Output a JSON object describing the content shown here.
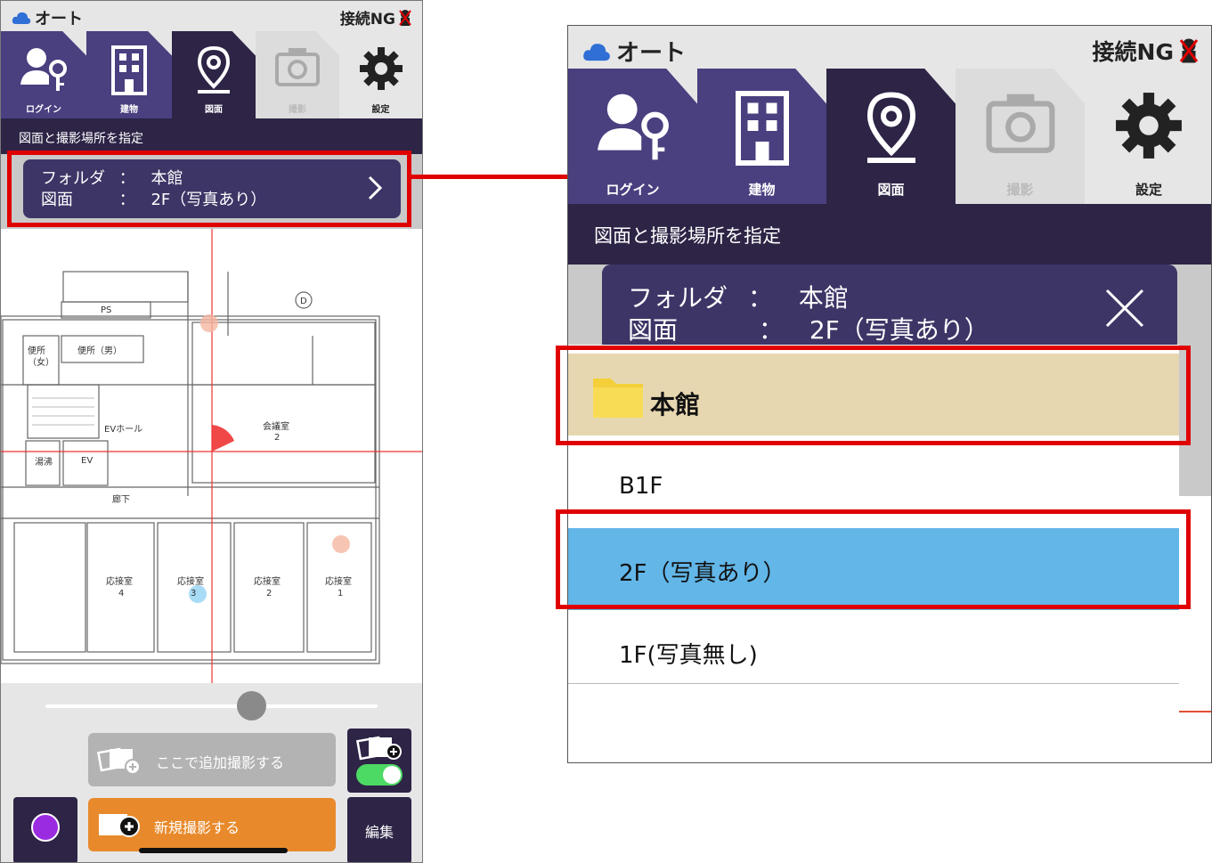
{
  "status": {
    "mode": "オート",
    "connection": "接続NG"
  },
  "tabs": [
    {
      "label": "ログイン",
      "icon": "user-key-icon"
    },
    {
      "label": "建物",
      "icon": "building-icon"
    },
    {
      "label": "図面",
      "icon": "map-pin-icon"
    },
    {
      "label": "撮影",
      "icon": "camera-icon"
    },
    {
      "label": "設定",
      "icon": "gear-icon"
    }
  ],
  "hint": "図面と撮影場所を指定",
  "folder": {
    "folder_label": "フォルダ",
    "folder_value": "本館",
    "drawing_label": "図面",
    "drawing_value": "2F（写真あり）",
    "sep": "："
  },
  "floorplan": {
    "rooms": [
      {
        "label": "PS"
      },
      {
        "label": "便所\n（女）"
      },
      {
        "label": "便所（男）"
      },
      {
        "label": "EVホール"
      },
      {
        "label": "会議室\n2"
      },
      {
        "label": "湯沸"
      },
      {
        "label": "EV"
      },
      {
        "label": "廊下"
      },
      {
        "label": "応接室\n4"
      },
      {
        "label": "応接室\n3"
      },
      {
        "label": "応接室\n2"
      },
      {
        "label": "応接室\n1"
      },
      {
        "label": "D"
      }
    ]
  },
  "actions": {
    "add_here": "ここで追加撮影する",
    "new_shot": "新規撮影する",
    "edit": "編集"
  },
  "list": {
    "folder_item": "本館",
    "items": [
      "B1F",
      "2F（写真あり）",
      "1F(写真無し)"
    ]
  },
  "colors": {
    "tab": "#4a3f7f",
    "tab_active": "#2e2446",
    "folder_bg": "#e7d7b0",
    "selected_bg": "#62b6e8",
    "accent_orange": "#e88a2c",
    "highlight_red": "#e00000",
    "color_dot": "#9a2be0"
  }
}
